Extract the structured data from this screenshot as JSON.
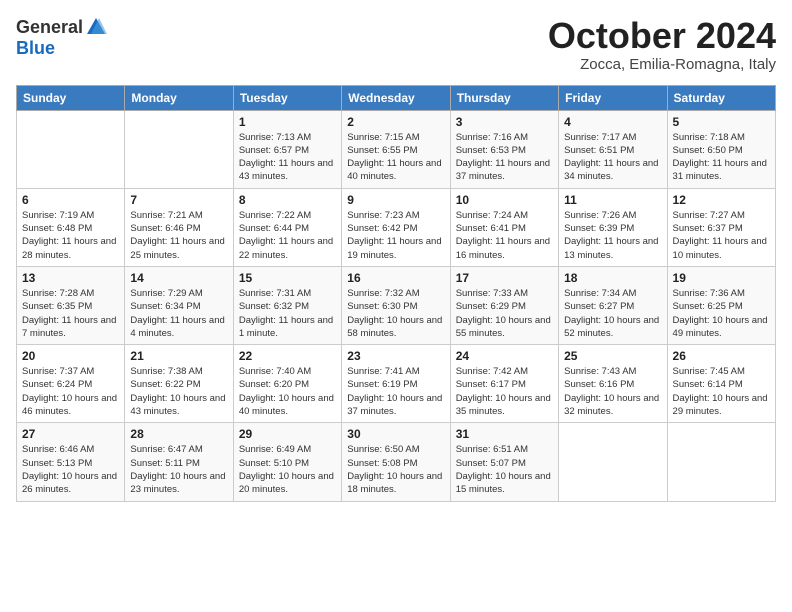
{
  "header": {
    "logo_line1": "General",
    "logo_line2": "Blue",
    "month": "October 2024",
    "location": "Zocca, Emilia-Romagna, Italy"
  },
  "days_of_week": [
    "Sunday",
    "Monday",
    "Tuesday",
    "Wednesday",
    "Thursday",
    "Friday",
    "Saturday"
  ],
  "weeks": [
    [
      null,
      null,
      {
        "day": 1,
        "sunrise": "7:13 AM",
        "sunset": "6:57 PM",
        "daylight": "11 hours and 43 minutes."
      },
      {
        "day": 2,
        "sunrise": "7:15 AM",
        "sunset": "6:55 PM",
        "daylight": "11 hours and 40 minutes."
      },
      {
        "day": 3,
        "sunrise": "7:16 AM",
        "sunset": "6:53 PM",
        "daylight": "11 hours and 37 minutes."
      },
      {
        "day": 4,
        "sunrise": "7:17 AM",
        "sunset": "6:51 PM",
        "daylight": "11 hours and 34 minutes."
      },
      {
        "day": 5,
        "sunrise": "7:18 AM",
        "sunset": "6:50 PM",
        "daylight": "11 hours and 31 minutes."
      }
    ],
    [
      {
        "day": 6,
        "sunrise": "7:19 AM",
        "sunset": "6:48 PM",
        "daylight": "11 hours and 28 minutes."
      },
      {
        "day": 7,
        "sunrise": "7:21 AM",
        "sunset": "6:46 PM",
        "daylight": "11 hours and 25 minutes."
      },
      {
        "day": 8,
        "sunrise": "7:22 AM",
        "sunset": "6:44 PM",
        "daylight": "11 hours and 22 minutes."
      },
      {
        "day": 9,
        "sunrise": "7:23 AM",
        "sunset": "6:42 PM",
        "daylight": "11 hours and 19 minutes."
      },
      {
        "day": 10,
        "sunrise": "7:24 AM",
        "sunset": "6:41 PM",
        "daylight": "11 hours and 16 minutes."
      },
      {
        "day": 11,
        "sunrise": "7:26 AM",
        "sunset": "6:39 PM",
        "daylight": "11 hours and 13 minutes."
      },
      {
        "day": 12,
        "sunrise": "7:27 AM",
        "sunset": "6:37 PM",
        "daylight": "11 hours and 10 minutes."
      }
    ],
    [
      {
        "day": 13,
        "sunrise": "7:28 AM",
        "sunset": "6:35 PM",
        "daylight": "11 hours and 7 minutes."
      },
      {
        "day": 14,
        "sunrise": "7:29 AM",
        "sunset": "6:34 PM",
        "daylight": "11 hours and 4 minutes."
      },
      {
        "day": 15,
        "sunrise": "7:31 AM",
        "sunset": "6:32 PM",
        "daylight": "11 hours and 1 minute."
      },
      {
        "day": 16,
        "sunrise": "7:32 AM",
        "sunset": "6:30 PM",
        "daylight": "10 hours and 58 minutes."
      },
      {
        "day": 17,
        "sunrise": "7:33 AM",
        "sunset": "6:29 PM",
        "daylight": "10 hours and 55 minutes."
      },
      {
        "day": 18,
        "sunrise": "7:34 AM",
        "sunset": "6:27 PM",
        "daylight": "10 hours and 52 minutes."
      },
      {
        "day": 19,
        "sunrise": "7:36 AM",
        "sunset": "6:25 PM",
        "daylight": "10 hours and 49 minutes."
      }
    ],
    [
      {
        "day": 20,
        "sunrise": "7:37 AM",
        "sunset": "6:24 PM",
        "daylight": "10 hours and 46 minutes."
      },
      {
        "day": 21,
        "sunrise": "7:38 AM",
        "sunset": "6:22 PM",
        "daylight": "10 hours and 43 minutes."
      },
      {
        "day": 22,
        "sunrise": "7:40 AM",
        "sunset": "6:20 PM",
        "daylight": "10 hours and 40 minutes."
      },
      {
        "day": 23,
        "sunrise": "7:41 AM",
        "sunset": "6:19 PM",
        "daylight": "10 hours and 37 minutes."
      },
      {
        "day": 24,
        "sunrise": "7:42 AM",
        "sunset": "6:17 PM",
        "daylight": "10 hours and 35 minutes."
      },
      {
        "day": 25,
        "sunrise": "7:43 AM",
        "sunset": "6:16 PM",
        "daylight": "10 hours and 32 minutes."
      },
      {
        "day": 26,
        "sunrise": "7:45 AM",
        "sunset": "6:14 PM",
        "daylight": "10 hours and 29 minutes."
      }
    ],
    [
      {
        "day": 27,
        "sunrise": "6:46 AM",
        "sunset": "5:13 PM",
        "daylight": "10 hours and 26 minutes."
      },
      {
        "day": 28,
        "sunrise": "6:47 AM",
        "sunset": "5:11 PM",
        "daylight": "10 hours and 23 minutes."
      },
      {
        "day": 29,
        "sunrise": "6:49 AM",
        "sunset": "5:10 PM",
        "daylight": "10 hours and 20 minutes."
      },
      {
        "day": 30,
        "sunrise": "6:50 AM",
        "sunset": "5:08 PM",
        "daylight": "10 hours and 18 minutes."
      },
      {
        "day": 31,
        "sunrise": "6:51 AM",
        "sunset": "5:07 PM",
        "daylight": "10 hours and 15 minutes."
      },
      null,
      null
    ]
  ]
}
